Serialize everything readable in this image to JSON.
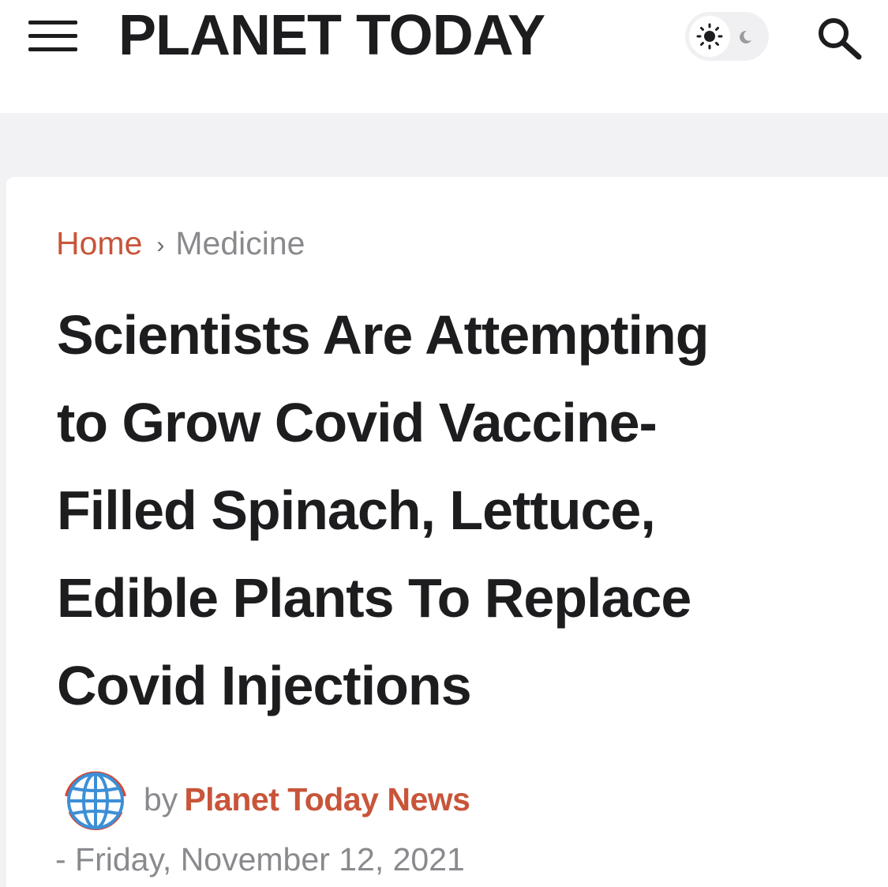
{
  "header": {
    "menu_icon": "hamburger-menu-icon",
    "site_title": "PLANET TODAY",
    "theme_toggle": {
      "sun_icon": "sun-icon",
      "moon_icon": "moon-icon",
      "mode": "light"
    },
    "search_icon": "search-icon"
  },
  "breadcrumb": {
    "home": "Home",
    "separator": "›",
    "current": "Medicine"
  },
  "article": {
    "title_lines": [
      "Scientists Are Attempting",
      "to Grow Covid Vaccine-",
      "Filled Spinach, Lettuce,",
      "Edible Plants To Replace",
      "Covid Injections"
    ],
    "byline_prefix": "by",
    "author": "Planet Today News",
    "author_icon": "globe-icon",
    "date": "- Friday, November 12, 2021"
  },
  "colors": {
    "accent": "#c8553a",
    "text": "#1d1d1f",
    "muted": "#8a8a8e",
    "page_bg": "#f2f2f4",
    "globe_blue": "#3c8fd6",
    "globe_red": "#d9452f"
  }
}
